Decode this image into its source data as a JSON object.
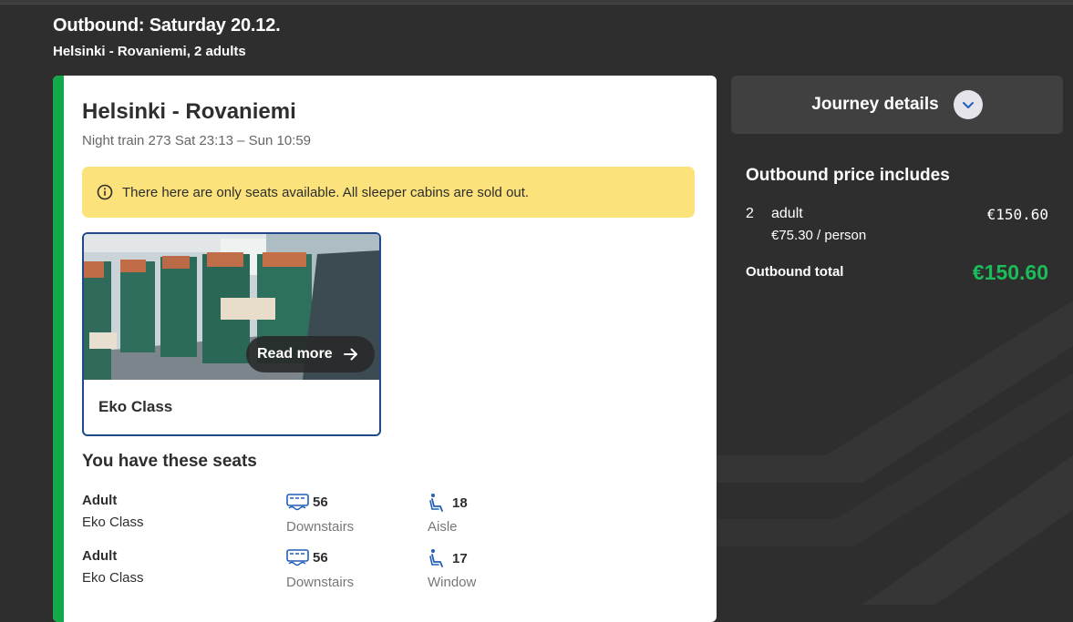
{
  "header": {
    "title": "Outbound: Saturday 20.12.",
    "subtitle": "Helsinki - Rovaniemi, 2 adults"
  },
  "card": {
    "route": "Helsinki - Rovaniemi",
    "train_info": "Night train 273 Sat 23:13 – Sun 10:59",
    "notice": "There here are only seats available. All sleeper cabins are sold out.",
    "class_card": {
      "read_more": "Read more",
      "class_name": "Eko Class"
    },
    "seats_title": "You have these seats",
    "seats": [
      {
        "passenger": "Adult",
        "class": "Eko Class",
        "car": "56",
        "car_location": "Downstairs",
        "seat": "18",
        "seat_type": "Aisle"
      },
      {
        "passenger": "Adult",
        "class": "Eko Class",
        "car": "56",
        "car_location": "Downstairs",
        "seat": "17",
        "seat_type": "Window"
      }
    ]
  },
  "sidebar": {
    "journey_details": "Journey details",
    "price_title": "Outbound price includes",
    "quantity": "2",
    "passenger_type": "adult",
    "amount": "€150.60",
    "per_person": "€75.30 / person",
    "total_label": "Outbound total",
    "total_value": "€150.60"
  },
  "colors": {
    "accent_green": "#13a84a",
    "total_green": "#1bbd5a",
    "notice_yellow": "#fbe27a",
    "card_border_blue": "#1f4a8a",
    "icon_blue": "#1f5fb8"
  }
}
